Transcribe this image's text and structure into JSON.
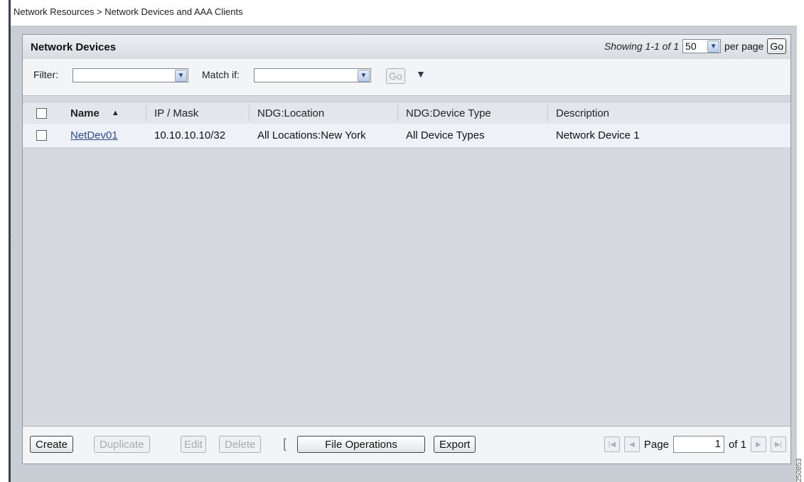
{
  "breadcrumb": "Network Resources > Network Devices and AAA Clients",
  "panel": {
    "title": "Network Devices",
    "showing": "Showing 1-1 of 1",
    "per_page_value": "50",
    "per_page_label": "per page",
    "go_label": "Go"
  },
  "filter": {
    "filter_label": "Filter:",
    "filter_value": "",
    "match_label": "Match if:",
    "match_value": "",
    "go_label": "Go"
  },
  "table": {
    "columns": [
      "Name",
      "IP / Mask",
      "NDG:Location",
      "NDG:Device Type",
      "Description"
    ],
    "sort_indicator": "▲",
    "rows": [
      {
        "name": "NetDev01",
        "ip_mask": "10.10.10.10/32",
        "location": "All Locations:New York",
        "device_type": "All Device Types",
        "description": "Network Device 1"
      }
    ]
  },
  "footer": {
    "create": "Create",
    "duplicate": "Duplicate",
    "edit": "Edit",
    "delete": "Delete",
    "bracket": "[",
    "file_operations": "File Operations",
    "export": "Export",
    "page_label": "Page",
    "page_value": "1",
    "page_of": "of 1"
  },
  "side_stamp": "250853",
  "icons": {
    "dropdown": "chevron-down-icon",
    "filter_menu": "triangle-down-icon",
    "sort": "sort-ascending-icon",
    "first": "first-page-icon",
    "prev": "prev-page-icon",
    "next": "next-page-icon",
    "last": "last-page-icon"
  }
}
